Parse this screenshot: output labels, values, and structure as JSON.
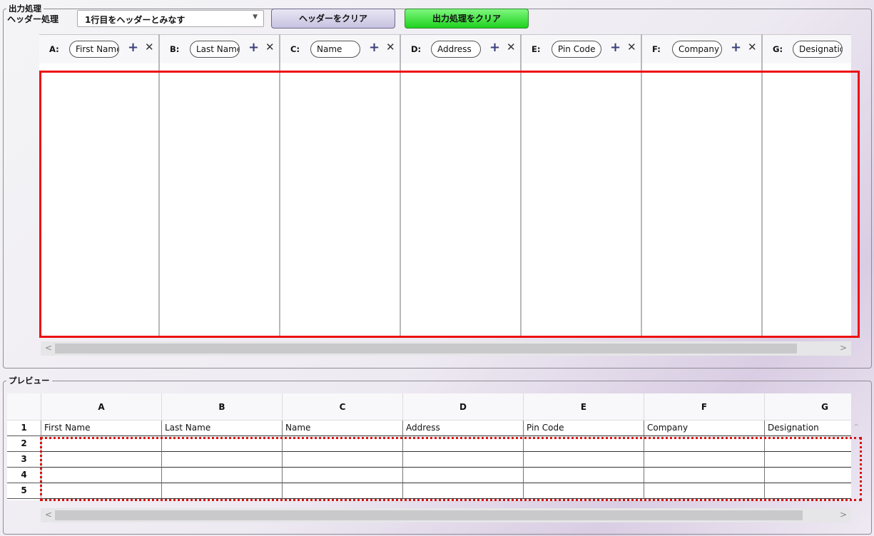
{
  "output_group": {
    "legend": "出力処理",
    "header_label": "ヘッダー処理",
    "header_select_value": "1行目をヘッダーとみなす",
    "clear_header_button": "ヘッダーをクリア",
    "clear_output_button": "出力処理をクリア",
    "columns": [
      {
        "letter": "A:",
        "name": "First Name"
      },
      {
        "letter": "B:",
        "name": "Last Name"
      },
      {
        "letter": "C:",
        "name": "Name"
      },
      {
        "letter": "D:",
        "name": "Address"
      },
      {
        "letter": "E:",
        "name": "Pin Code"
      },
      {
        "letter": "F:",
        "name": "Company"
      },
      {
        "letter": "G:",
        "name": "Designation"
      }
    ],
    "plus_symbol": "+",
    "remove_symbol": "✕"
  },
  "preview_group": {
    "legend": "プレビュー",
    "column_headers": [
      "A",
      "B",
      "C",
      "D",
      "E",
      "F",
      "G"
    ],
    "row_numbers": [
      "1",
      "2",
      "3",
      "4",
      "5"
    ],
    "rows": [
      [
        "First Name",
        "Last Name",
        "Name",
        "Address",
        "Pin Code",
        "Company",
        "Designation"
      ],
      [
        "",
        "",
        "",
        "",
        "",
        "",
        ""
      ],
      [
        "",
        "",
        "",
        "",
        "",
        "",
        ""
      ],
      [
        "",
        "",
        "",
        "",
        "",
        "",
        ""
      ],
      [
        "",
        "",
        "",
        "",
        "",
        "",
        ""
      ]
    ]
  },
  "scroll": {
    "left_arrow": "<",
    "right_arrow": ">",
    "up_arrow": "^"
  },
  "colors": {
    "highlight_red": "#ee1111",
    "green_button": "#1fd21f",
    "lavender_button": "#c7c2e0"
  }
}
